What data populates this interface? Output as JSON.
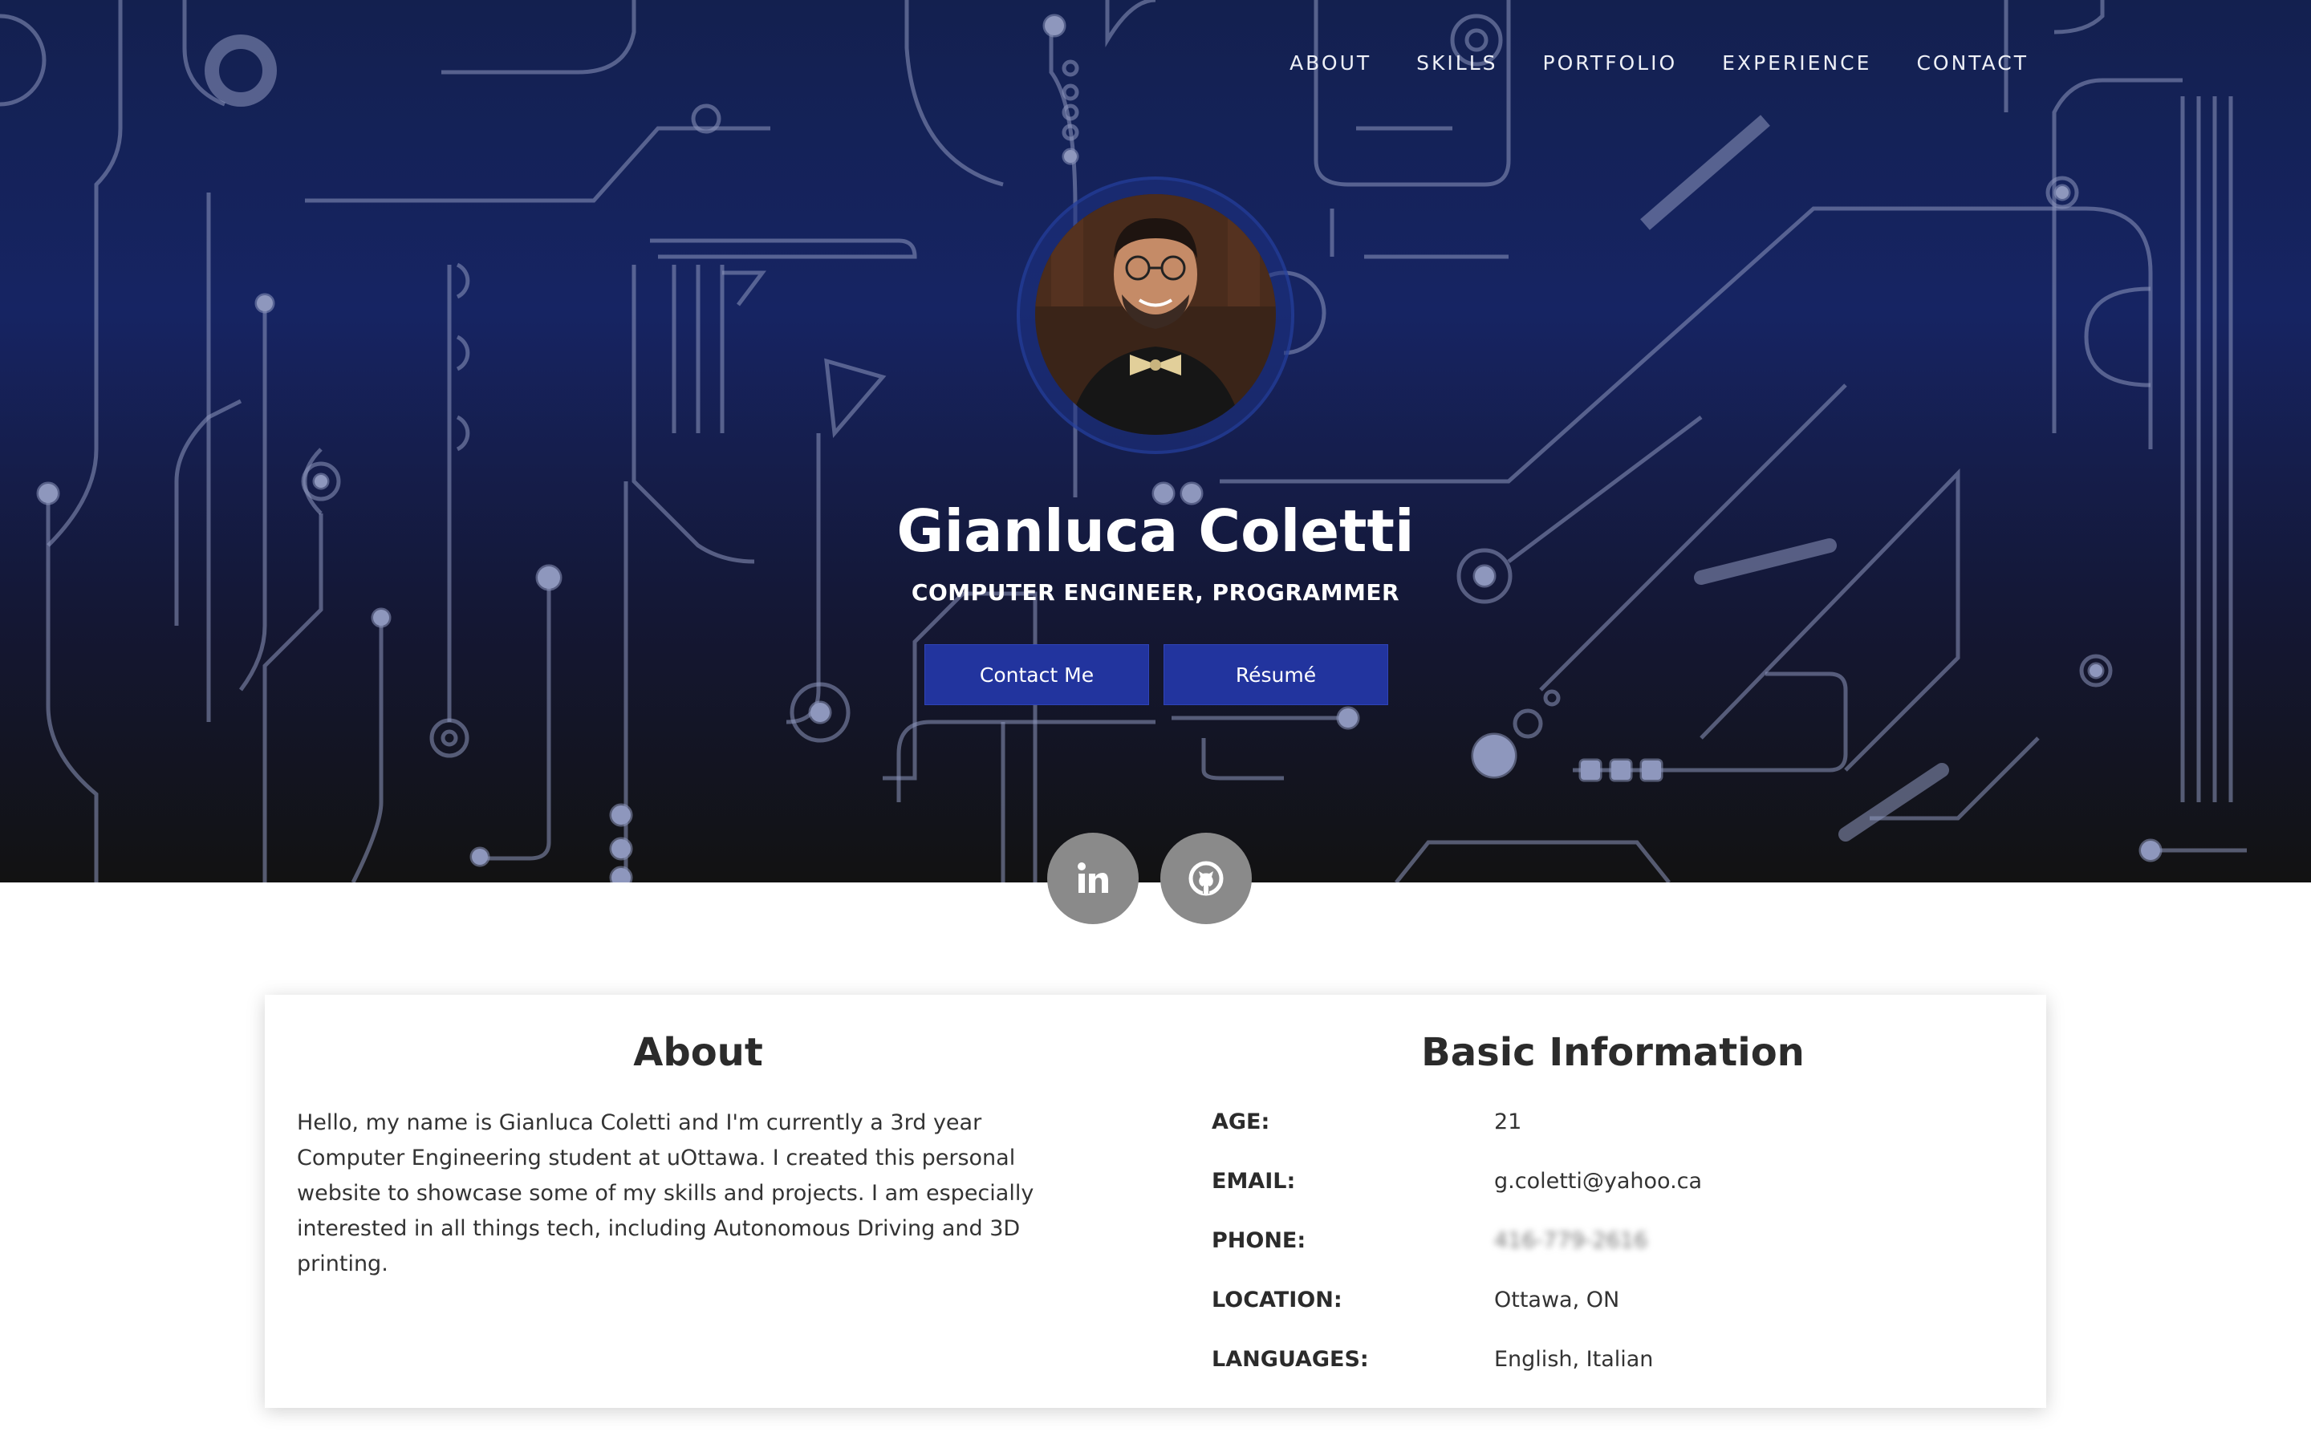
{
  "nav": {
    "items": [
      "ABOUT",
      "SKILLS",
      "PORTFOLIO",
      "EXPERIENCE",
      "CONTACT"
    ]
  },
  "hero": {
    "name": "Gianluca Coletti",
    "subtitle": "COMPUTER ENGINEER, PROGRAMMER",
    "contact_button": "Contact Me",
    "resume_button": "Résumé"
  },
  "social": {
    "linkedin": "in",
    "github_icon": "github-icon"
  },
  "about": {
    "title": "About",
    "text": "Hello, my name is Gianluca Coletti and I'm currently a 3rd year Computer Engineering student at uOttawa. I created this personal website to showcase some of my skills and projects. I am especially interested in all things tech, including Autonomous Driving and 3D printing."
  },
  "info": {
    "title": "Basic Information",
    "rows": [
      {
        "label": "AGE:",
        "value": "21"
      },
      {
        "label": "EMAIL:",
        "value": "g.coletti@yahoo.ca"
      },
      {
        "label": "PHONE:",
        "value": "416-779-2616"
      },
      {
        "label": "LOCATION:",
        "value": "Ottawa, ON"
      },
      {
        "label": "LANGUAGES:",
        "value": "English, Italian"
      }
    ]
  },
  "colors": {
    "accent_button": "#22349e",
    "hero_top": "#13204f",
    "hero_bottom": "#121212",
    "social_bg": "#8a8a8a"
  }
}
